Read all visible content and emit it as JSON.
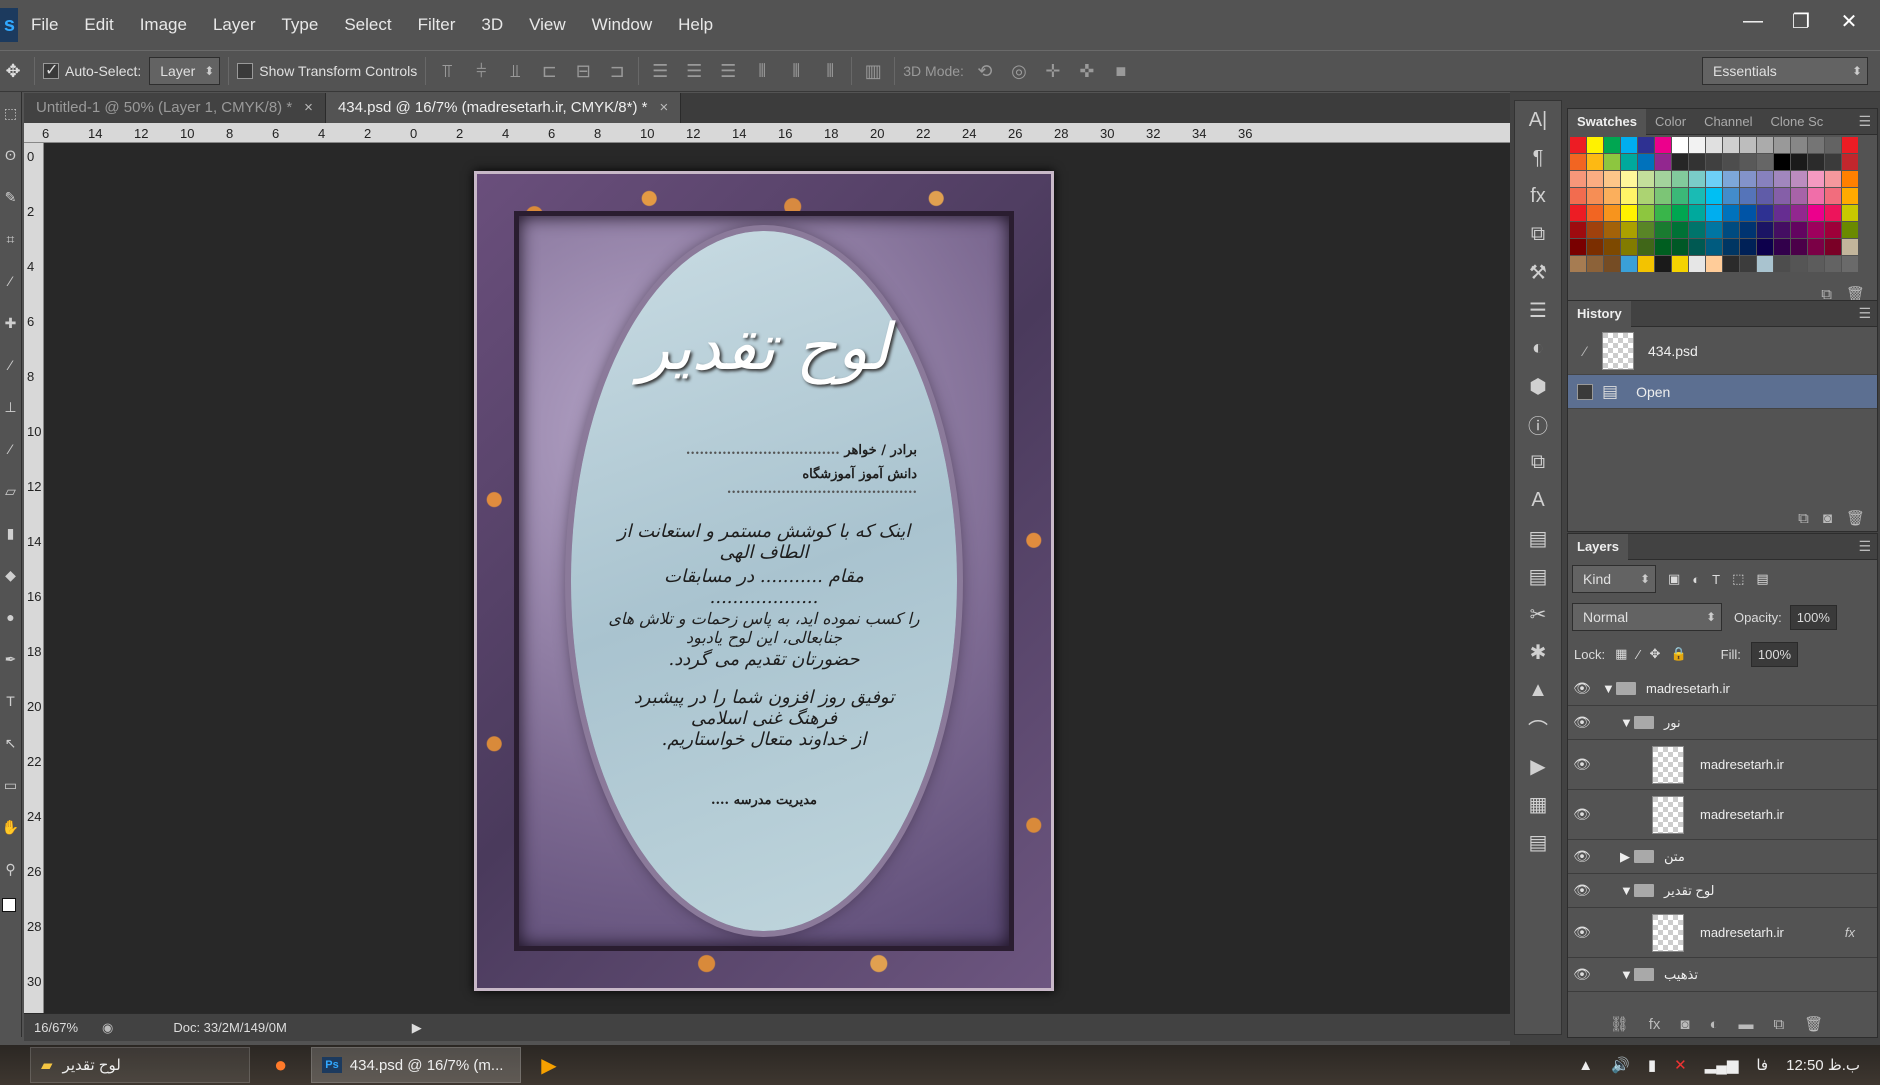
{
  "menubar": {
    "logo": "s",
    "items": [
      "File",
      "Edit",
      "Image",
      "Layer",
      "Type",
      "Select",
      "Filter",
      "3D",
      "View",
      "Window",
      "Help"
    ],
    "win_controls": {
      "minimize": "—",
      "restore": "❐",
      "close": "✕"
    }
  },
  "options_bar": {
    "auto_select_label": "Auto-Select:",
    "auto_select_value": "Layer",
    "show_transform_label": "Show Transform Controls",
    "mode_3d_label": "3D Mode:",
    "workspace": "Essentials"
  },
  "doc_tabs": [
    {
      "label": "Untitled-1 @ 50% (Layer 1, CMYK/8) *",
      "close": "×"
    },
    {
      "label": "434.psd @ 16/7% (madresetarh.ir, CMYK/8*) *",
      "close": "×"
    }
  ],
  "ruler_h_labels": [
    "6",
    "14",
    "12",
    "10",
    "8",
    "6",
    "4",
    "2",
    "0",
    "2",
    "4",
    "6",
    "8",
    "10",
    "12",
    "14",
    "16",
    "18",
    "20",
    "22",
    "24",
    "26",
    "28",
    "30",
    "32",
    "34",
    "36"
  ],
  "ruler_v_labels": [
    "0",
    "2",
    "4",
    "6",
    "8",
    "10",
    "12",
    "14",
    "16",
    "18",
    "20",
    "22",
    "24",
    "26",
    "28",
    "30"
  ],
  "status": {
    "zoom": "16/67%",
    "doc": "Doc: 33/2M/149/0M"
  },
  "certificate": {
    "title": "لوح تقدیر",
    "line1": "برادر / خواهر",
    "line2": "دانش آموز آموزشگاه",
    "dots1": "..................................",
    "dots2": "..........................................",
    "body1": "اینک که با کوشش مستمر و استعانت از الطاف الهی",
    "body2": "مقام ........... در مسابقات ...................",
    "body3": "را کسب نموده اید، به پاس زحمات و تلاش های جنابعالی، این لوح یادبود",
    "body4": "حضورتان تقدیم می گردد.",
    "body5": "توفیق روز افزون شما را در پیشبرد فرهنگ غنی اسلامی",
    "body6": "از خداوند متعال خواستاریم.",
    "sign": "مدیریت مدرسه ...."
  },
  "swatches_panel": {
    "tabs": [
      "Swatches",
      "Color",
      "Channel",
      "Clone Sc"
    ],
    "colors": [
      "#ed1c24",
      "#fff200",
      "#00a651",
      "#00aeef",
      "#2e3192",
      "#ec008c",
      "#ffffff",
      "#f2f2f2",
      "#e0e0e0",
      "#cfcfcf",
      "#bdbdbd",
      "#ababab",
      "#999999",
      "#878787",
      "#757575",
      "#636363",
      "#ed1c24",
      "#f26522",
      "#fdb913",
      "#8dc63f",
      "#00a99d",
      "#0072bc",
      "#92278f",
      "#262626",
      "#333333",
      "#404040",
      "#4d4d4d",
      "#595959",
      "#666666",
      "#000000",
      "#1a1a1a",
      "#2b2b2b",
      "#3b3b3b",
      "#c1272d",
      "#f7977a",
      "#fbad82",
      "#fdc689",
      "#fff79a",
      "#c4df9b",
      "#a3d39c",
      "#82ca9c",
      "#7accc8",
      "#6dcff6",
      "#7da7d9",
      "#8393ca",
      "#8781bd",
      "#a187be",
      "#bc8cbf",
      "#f49ac1",
      "#f5989d",
      "#ff8000",
      "#f26c4f",
      "#f68e55",
      "#fbaf5c",
      "#fff467",
      "#acd372",
      "#7cc576",
      "#3bb878",
      "#1abbb4",
      "#00bff3",
      "#438ccb",
      "#5574b9",
      "#605ca8",
      "#855fa8",
      "#a763a8",
      "#f06ea9",
      "#f26d7d",
      "#ffaa00",
      "#ed1c24",
      "#f26522",
      "#f7941d",
      "#fff200",
      "#8dc63f",
      "#39b54a",
      "#00a651",
      "#00a99d",
      "#00aeef",
      "#0072bc",
      "#0054a6",
      "#2e3192",
      "#662d91",
      "#92278f",
      "#ec008c",
      "#ed145b",
      "#c8c800",
      "#9e0b0f",
      "#a0410d",
      "#a36209",
      "#aba000",
      "#598527",
      "#1a7b30",
      "#007236",
      "#00746b",
      "#0076a3",
      "#004b80",
      "#003471",
      "#1b1464",
      "#440e62",
      "#630460",
      "#9e005d",
      "#9e0039",
      "#6a8a00",
      "#790000",
      "#7b2e00",
      "#7d4900",
      "#827b00",
      "#406618",
      "#005e20",
      "#005826",
      "#005952",
      "#005b7f",
      "#003663",
      "#002157",
      "#0d004c",
      "#32004b",
      "#4b0049",
      "#7b0046",
      "#7a0026",
      "#c2b59b",
      "#a67c52",
      "#8c6239",
      "#754c24",
      "#3aa0d8",
      "#f3c300",
      "#1a1a1a",
      "#f5d300",
      "#e6e6e6",
      "#ffcc99",
      "#2b2b2b",
      "#3c3c3c",
      "#a9c3cf",
      "#4d4d4d",
      "#555555",
      "#5c5c5c",
      "#636363",
      "#6a6a6a"
    ]
  },
  "history_panel": {
    "title": "History",
    "rows": [
      {
        "label": "434.psd"
      },
      {
        "label": "Open"
      }
    ]
  },
  "layers_panel": {
    "title": "Layers",
    "kind_label": "Kind",
    "blend_mode": "Normal",
    "opacity_label": "Opacity:",
    "opacity_value": "100%",
    "lock_label": "Lock:",
    "fill_label": "Fill:",
    "fill_value": "100%",
    "fx_label": "fx",
    "layers": [
      {
        "name": "madresetarh.ir",
        "type": "group",
        "indent": 0
      },
      {
        "name": "نور",
        "type": "group",
        "indent": 1
      },
      {
        "name": "madresetarh.ir",
        "type": "layer",
        "indent": 2
      },
      {
        "name": "madresetarh.ir",
        "type": "layer",
        "indent": 2
      },
      {
        "name": "متن",
        "type": "group-closed",
        "indent": 1
      },
      {
        "name": "لوح تقدیر",
        "type": "group",
        "indent": 1
      },
      {
        "name": "madresetarh.ir",
        "type": "layer-fx",
        "indent": 2
      },
      {
        "name": "تذهیب",
        "type": "group",
        "indent": 1
      }
    ]
  },
  "taskbar": {
    "items": [
      {
        "label": "لوح تقدیر"
      },
      {
        "label": "434.psd @ 16/7% (m..."
      }
    ],
    "lang": "فا",
    "time": "12:50 ب.ظ"
  }
}
